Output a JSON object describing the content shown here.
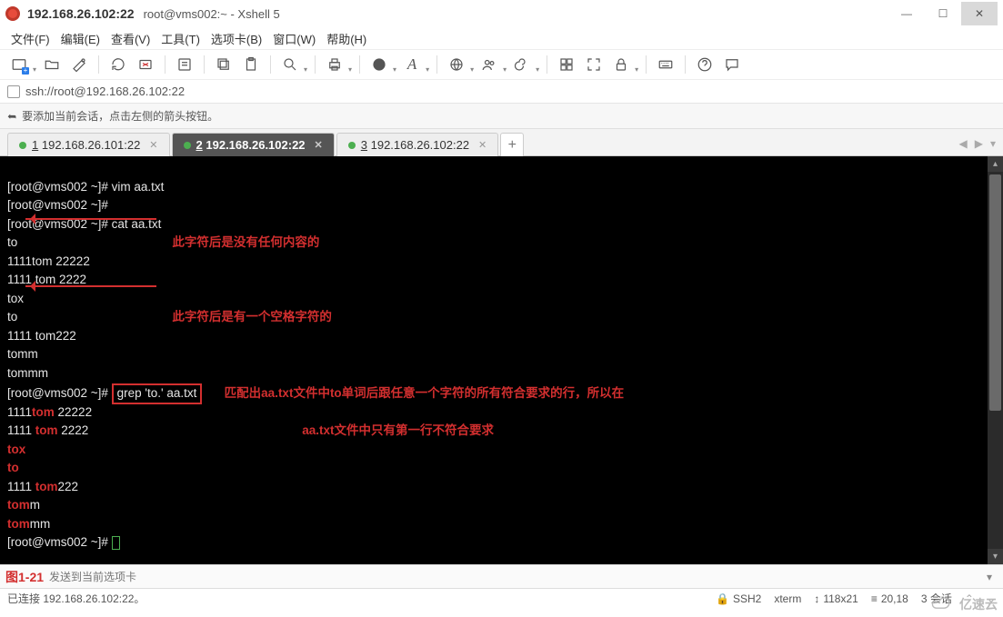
{
  "titlebar": {
    "host": "192.168.26.102:22",
    "sub": "root@vms002:~ - Xshell 5"
  },
  "menu": [
    "文件(F)",
    "编辑(E)",
    "查看(V)",
    "工具(T)",
    "选项卡(B)",
    "窗口(W)",
    "帮助(H)"
  ],
  "address": "ssh://root@192.168.26.102:22",
  "hint": "要添加当前会话，点击左侧的箭头按钮。",
  "tabs": {
    "items": [
      {
        "num": "1",
        "label": "192.168.26.101:22",
        "active": false
      },
      {
        "num": "2",
        "label": "192.168.26.102:22",
        "active": true
      },
      {
        "num": "3",
        "label": "192.168.26.102:22",
        "active": false
      }
    ]
  },
  "term": {
    "l1": "[root@vms002 ~]# vim aa.txt",
    "l2": "[root@vms002 ~]#",
    "l3": "[root@vms002 ~]# cat aa.txt",
    "l4": "to",
    "l5": "1111tom 22222",
    "l6": "1111 tom 2222",
    "l7": "tox",
    "l8": "to",
    "l9": "1111 tom222",
    "l10": "tomm",
    "l11": "tommm",
    "l12_prompt": "[root@vms002 ~]# ",
    "l12_cmd": "grep 'to.' aa.txt",
    "l13_a": "1111",
    "l13_b": "tom",
    "l13_c": " 22222",
    "l14_a": "1111 ",
    "l14_b": "tom",
    "l14_c": " 2222",
    "l15": "tox",
    "l16_a": "to ",
    "l16_b": "",
    "l17_a": "1111 ",
    "l17_b": "tom",
    "l17_c": "222",
    "l18_a": "tom",
    "l18_b": "m",
    "l19_a": "tom",
    "l19_b": "mm",
    "l20": "[root@vms002 ~]# ",
    "ann1": "此字符后是没有任何内容的",
    "ann2": "此字符后是有一个空格字符的",
    "ann3a": "匹配出aa.txt文件中to单词后跟任意一个字符的所有符合要求的行，所以在",
    "ann3b": "aa.txt文件中只有第一行不符合要求"
  },
  "figure_label": "图1-21",
  "input_placeholder": "发送到当前选项卡",
  "status": {
    "conn": "已连接 192.168.26.102:22。",
    "proto": "SSH2",
    "term": "xterm",
    "size": "118x21",
    "pos": "20,18",
    "sess": "3 会话"
  },
  "watermark": "亿速云"
}
